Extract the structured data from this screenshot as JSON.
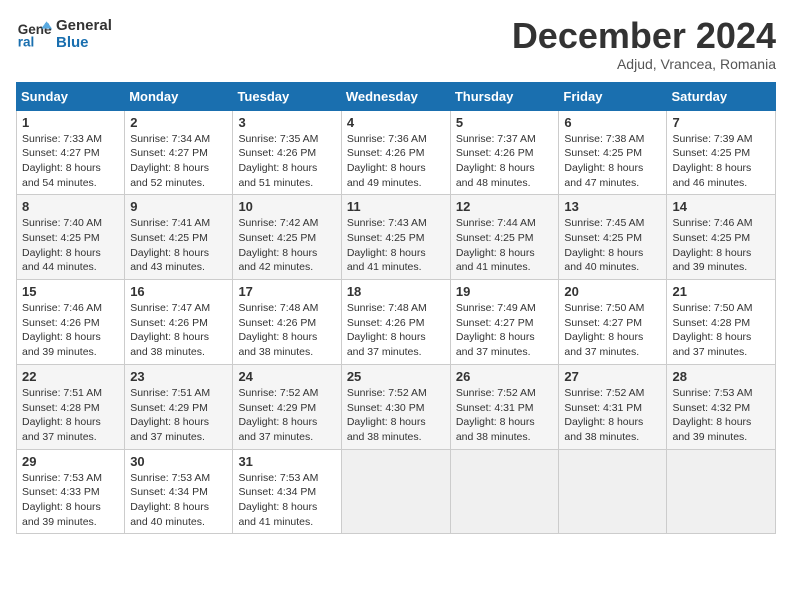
{
  "header": {
    "logo_line1": "General",
    "logo_line2": "Blue",
    "month": "December 2024",
    "location": "Adjud, Vrancea, Romania"
  },
  "days_of_week": [
    "Sunday",
    "Monday",
    "Tuesday",
    "Wednesday",
    "Thursday",
    "Friday",
    "Saturday"
  ],
  "weeks": [
    [
      {
        "day": "1",
        "detail": "Sunrise: 7:33 AM\nSunset: 4:27 PM\nDaylight: 8 hours\nand 54 minutes."
      },
      {
        "day": "2",
        "detail": "Sunrise: 7:34 AM\nSunset: 4:27 PM\nDaylight: 8 hours\nand 52 minutes."
      },
      {
        "day": "3",
        "detail": "Sunrise: 7:35 AM\nSunset: 4:26 PM\nDaylight: 8 hours\nand 51 minutes."
      },
      {
        "day": "4",
        "detail": "Sunrise: 7:36 AM\nSunset: 4:26 PM\nDaylight: 8 hours\nand 49 minutes."
      },
      {
        "day": "5",
        "detail": "Sunrise: 7:37 AM\nSunset: 4:26 PM\nDaylight: 8 hours\nand 48 minutes."
      },
      {
        "day": "6",
        "detail": "Sunrise: 7:38 AM\nSunset: 4:25 PM\nDaylight: 8 hours\nand 47 minutes."
      },
      {
        "day": "7",
        "detail": "Sunrise: 7:39 AM\nSunset: 4:25 PM\nDaylight: 8 hours\nand 46 minutes."
      }
    ],
    [
      {
        "day": "8",
        "detail": "Sunrise: 7:40 AM\nSunset: 4:25 PM\nDaylight: 8 hours\nand 44 minutes."
      },
      {
        "day": "9",
        "detail": "Sunrise: 7:41 AM\nSunset: 4:25 PM\nDaylight: 8 hours\nand 43 minutes."
      },
      {
        "day": "10",
        "detail": "Sunrise: 7:42 AM\nSunset: 4:25 PM\nDaylight: 8 hours\nand 42 minutes."
      },
      {
        "day": "11",
        "detail": "Sunrise: 7:43 AM\nSunset: 4:25 PM\nDaylight: 8 hours\nand 41 minutes."
      },
      {
        "day": "12",
        "detail": "Sunrise: 7:44 AM\nSunset: 4:25 PM\nDaylight: 8 hours\nand 41 minutes."
      },
      {
        "day": "13",
        "detail": "Sunrise: 7:45 AM\nSunset: 4:25 PM\nDaylight: 8 hours\nand 40 minutes."
      },
      {
        "day": "14",
        "detail": "Sunrise: 7:46 AM\nSunset: 4:25 PM\nDaylight: 8 hours\nand 39 minutes."
      }
    ],
    [
      {
        "day": "15",
        "detail": "Sunrise: 7:46 AM\nSunset: 4:26 PM\nDaylight: 8 hours\nand 39 minutes."
      },
      {
        "day": "16",
        "detail": "Sunrise: 7:47 AM\nSunset: 4:26 PM\nDaylight: 8 hours\nand 38 minutes."
      },
      {
        "day": "17",
        "detail": "Sunrise: 7:48 AM\nSunset: 4:26 PM\nDaylight: 8 hours\nand 38 minutes."
      },
      {
        "day": "18",
        "detail": "Sunrise: 7:48 AM\nSunset: 4:26 PM\nDaylight: 8 hours\nand 37 minutes."
      },
      {
        "day": "19",
        "detail": "Sunrise: 7:49 AM\nSunset: 4:27 PM\nDaylight: 8 hours\nand 37 minutes."
      },
      {
        "day": "20",
        "detail": "Sunrise: 7:50 AM\nSunset: 4:27 PM\nDaylight: 8 hours\nand 37 minutes."
      },
      {
        "day": "21",
        "detail": "Sunrise: 7:50 AM\nSunset: 4:28 PM\nDaylight: 8 hours\nand 37 minutes."
      }
    ],
    [
      {
        "day": "22",
        "detail": "Sunrise: 7:51 AM\nSunset: 4:28 PM\nDaylight: 8 hours\nand 37 minutes."
      },
      {
        "day": "23",
        "detail": "Sunrise: 7:51 AM\nSunset: 4:29 PM\nDaylight: 8 hours\nand 37 minutes."
      },
      {
        "day": "24",
        "detail": "Sunrise: 7:52 AM\nSunset: 4:29 PM\nDaylight: 8 hours\nand 37 minutes."
      },
      {
        "day": "25",
        "detail": "Sunrise: 7:52 AM\nSunset: 4:30 PM\nDaylight: 8 hours\nand 38 minutes."
      },
      {
        "day": "26",
        "detail": "Sunrise: 7:52 AM\nSunset: 4:31 PM\nDaylight: 8 hours\nand 38 minutes."
      },
      {
        "day": "27",
        "detail": "Sunrise: 7:52 AM\nSunset: 4:31 PM\nDaylight: 8 hours\nand 38 minutes."
      },
      {
        "day": "28",
        "detail": "Sunrise: 7:53 AM\nSunset: 4:32 PM\nDaylight: 8 hours\nand 39 minutes."
      }
    ],
    [
      {
        "day": "29",
        "detail": "Sunrise: 7:53 AM\nSunset: 4:33 PM\nDaylight: 8 hours\nand 39 minutes."
      },
      {
        "day": "30",
        "detail": "Sunrise: 7:53 AM\nSunset: 4:34 PM\nDaylight: 8 hours\nand 40 minutes."
      },
      {
        "day": "31",
        "detail": "Sunrise: 7:53 AM\nSunset: 4:34 PM\nDaylight: 8 hours\nand 41 minutes."
      },
      {
        "day": "",
        "detail": ""
      },
      {
        "day": "",
        "detail": ""
      },
      {
        "day": "",
        "detail": ""
      },
      {
        "day": "",
        "detail": ""
      }
    ]
  ]
}
